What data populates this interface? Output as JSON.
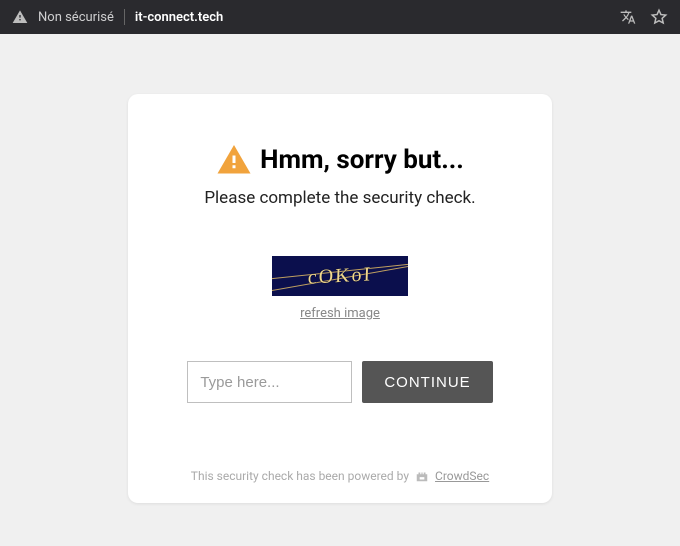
{
  "addressBar": {
    "securityLabel": "Non sécurisé",
    "domain": "it-connect.tech"
  },
  "card": {
    "heading": "Hmm, sorry but...",
    "subtitle": "Please complete the security check.",
    "captchaText": "cOKoI",
    "refreshLabel": "refresh image",
    "inputPlaceholder": "Type here...",
    "continueLabel": "CONTINUE",
    "footerText": "This security check has been powered by",
    "footerLink": "CrowdSec"
  },
  "colors": {
    "captchaBg": "#0b0f4d",
    "warning": "#f1a33c"
  }
}
